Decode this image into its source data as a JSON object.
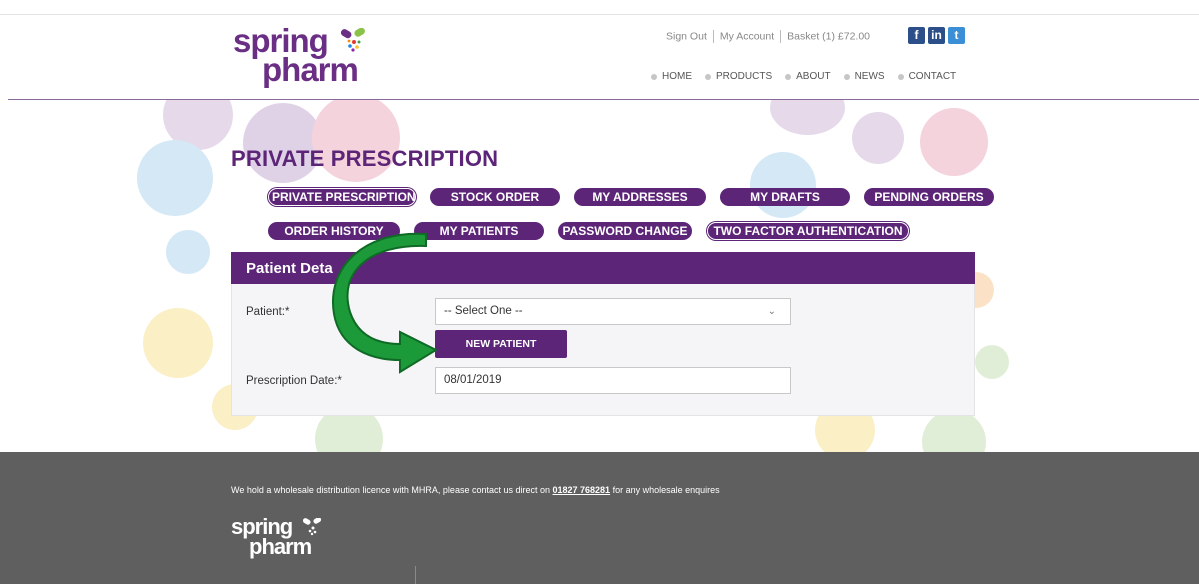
{
  "brand": {
    "line1": "spring",
    "line2": "pharm"
  },
  "top_links": {
    "sign_out": "Sign Out",
    "my_account": "My Account",
    "basket": "Basket (1) £72.00"
  },
  "social": {
    "facebook": "f",
    "linkedin": "in",
    "twitter": "t"
  },
  "main_nav": [
    "HOME",
    "PRODUCTS",
    "ABOUT",
    "NEWS",
    "CONTACT"
  ],
  "page_title": "PRIVATE PRESCRIPTION",
  "tabs": {
    "private_prescription": "PRIVATE PRESCRIPTION",
    "stock_order": "STOCK ORDER",
    "my_addresses": "MY ADDRESSES",
    "my_drafts": "MY DRAFTS",
    "pending_orders": "PENDING ORDERS",
    "order_history": "ORDER HISTORY",
    "my_patients": "MY PATIENTS",
    "password_change": "PASSWORD CHANGE",
    "two_factor": "TWO FACTOR AUTHENTICATION"
  },
  "form": {
    "panel_title": "Patient Deta",
    "patient_label": "Patient:*",
    "patient_value": "-- Select One --",
    "new_patient_button": "NEW PATIENT",
    "date_label": "Prescription Date:*",
    "date_value": "08/01/2019"
  },
  "footer": {
    "text_before": "We hold a wholesale distribution licence with MHRA, please contact us direct on ",
    "phone": "01827 768281",
    "text_after": " for any wholesale enquires",
    "logo_line1": "spring",
    "logo_line2": "pharm"
  },
  "colors": {
    "brand_purple": "#5c2577",
    "arrow_green": "#1c9a3a",
    "footer_gray": "#5f5f5f"
  }
}
